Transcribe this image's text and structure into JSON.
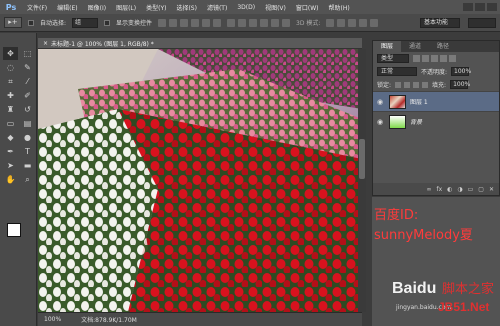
{
  "app": {
    "logo": "Ps"
  },
  "menu": [
    "文件(F)",
    "编辑(E)",
    "图像(I)",
    "图层(L)",
    "类型(Y)",
    "选择(S)",
    "滤镜(T)",
    "3D(D)",
    "视图(V)",
    "窗口(W)",
    "帮助(H)"
  ],
  "options": {
    "tool_glyph": "▸+",
    "auto_select_label": "自动选择:",
    "auto_select_value": "组",
    "show_transform_label": "显示变换控件",
    "mode_label": "3D 模式:",
    "workspace_value": "基本功能"
  },
  "document": {
    "tab_title": "未标题-1 @ 100% (图层 1, RGB/8) *",
    "zoom": "100%",
    "file_info": "文档:878.9K/1.70M"
  },
  "tools": [
    "move",
    "marquee",
    "lasso",
    "quick-select",
    "crop",
    "eyedropper",
    "heal",
    "brush",
    "stamp",
    "history-brush",
    "eraser",
    "gradient",
    "blur",
    "dodge",
    "pen",
    "type",
    "path-select",
    "shape",
    "hand",
    "zoom"
  ],
  "colors": {
    "foreground": "#ffffff",
    "background": "#4ad12a",
    "accent": "#ff3b3b"
  },
  "layers_panel": {
    "tabs": [
      "图层",
      "通道",
      "路径"
    ],
    "kind_label": "类型",
    "blend_mode": "正常",
    "opacity_label": "不透明度:",
    "opacity_value": "100%",
    "lock_label": "锁定:",
    "fill_label": "填充:",
    "fill_value": "100%",
    "layers": [
      {
        "name": "图层 1",
        "selected": true
      },
      {
        "name": "背景",
        "selected": false
      }
    ],
    "footer": "fx"
  },
  "overlay": {
    "credit_line1": "百度ID:",
    "credit_line2": "sunnyMelody夏",
    "watermark_baidu": "Baidu",
    "watermark_site": "脚本之家",
    "watermark_jb": "JB51.Net",
    "watermark_jingyan": "jingyan.baidu.com"
  }
}
